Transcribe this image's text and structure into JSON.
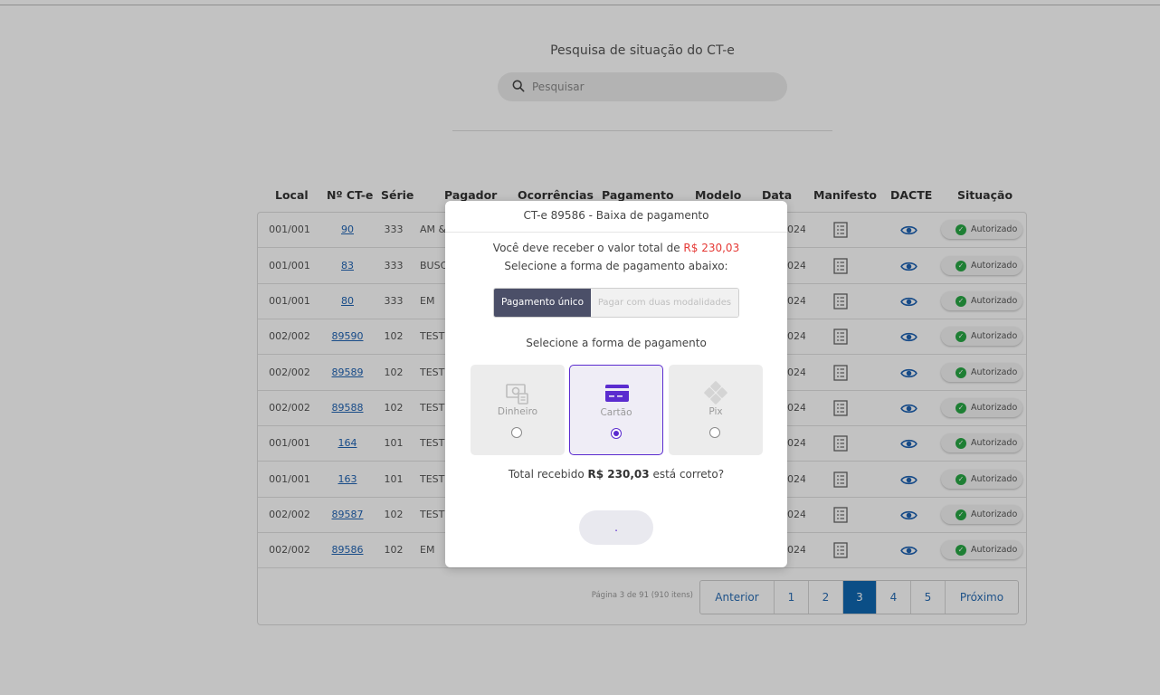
{
  "search": {
    "title": "Pesquisa de situação do CT-e",
    "placeholder": "Pesquisar"
  },
  "table": {
    "headers": [
      "Local",
      "Nº CT-e",
      "Série",
      "Pagador",
      "Ocorrências",
      "Pagamento",
      "Modelo",
      "Data",
      "Manifesto",
      "DACTE",
      "Situação"
    ],
    "rows": [
      {
        "local": "001/001",
        "cte": "90",
        "serie": "333",
        "pagador": "AM &",
        "data": "024",
        "situacao": "Autorizado"
      },
      {
        "local": "001/001",
        "cte": "83",
        "serie": "333",
        "pagador": "BUSC",
        "data": "024",
        "situacao": "Autorizado"
      },
      {
        "local": "001/001",
        "cte": "80",
        "serie": "333",
        "pagador": "EM",
        "data": "024",
        "situacao": "Autorizado"
      },
      {
        "local": "002/002",
        "cte": "89590",
        "serie": "102",
        "pagador": "TESTE",
        "data": "024",
        "situacao": "Autorizado"
      },
      {
        "local": "002/002",
        "cte": "89589",
        "serie": "102",
        "pagador": "TESTE",
        "data": "024",
        "situacao": "Autorizado"
      },
      {
        "local": "002/002",
        "cte": "89588",
        "serie": "102",
        "pagador": "TESTE",
        "data": "024",
        "situacao": "Autorizado"
      },
      {
        "local": "001/001",
        "cte": "164",
        "serie": "101",
        "pagador": "TESTE",
        "data": "024",
        "situacao": "Autorizado"
      },
      {
        "local": "001/001",
        "cte": "163",
        "serie": "101",
        "pagador": "TESTE",
        "data": "024",
        "situacao": "Autorizado"
      },
      {
        "local": "002/002",
        "cte": "89587",
        "serie": "102",
        "pagador": "TESTE",
        "data": "024",
        "situacao": "Autorizado"
      },
      {
        "local": "002/002",
        "cte": "89586",
        "serie": "102",
        "pagador": "EM",
        "data": "024",
        "situacao": "Autorizado"
      }
    ]
  },
  "pagination": {
    "info": "Página 3 de 91 (910 itens)",
    "prev": "Anterior",
    "pages": [
      "1",
      "2",
      "3",
      "4",
      "5"
    ],
    "active_page": "3",
    "next": "Próximo"
  },
  "modal": {
    "title": "CT-e 89586 - Baixa de pagamento",
    "receive_prefix": "Você deve receber o valor total de",
    "receive_amount": "R$ 230,03",
    "select_below": "Selecione a forma de pagamento abaixo:",
    "mode_single": "Pagamento único",
    "mode_double": "Pagar com duas modalidades",
    "select_method": "Selecione a forma de pagamento",
    "methods": [
      {
        "label": "Dinheiro",
        "icon": "cash-icon",
        "selected": false
      },
      {
        "label": "Cartão",
        "icon": "credit-card-icon",
        "selected": true
      },
      {
        "label": "Pix",
        "icon": "pix-icon",
        "selected": false
      }
    ],
    "total_prefix": "Total recebido",
    "total_amount": "R$ 230,03",
    "total_suffix": "está correto?",
    "confirm_label": "."
  },
  "colors": {
    "accent": "#5b2ccf",
    "active_page": "#0f67b1",
    "link": "#1f63b3",
    "success": "#28a745",
    "amount_red": "#e53935"
  }
}
